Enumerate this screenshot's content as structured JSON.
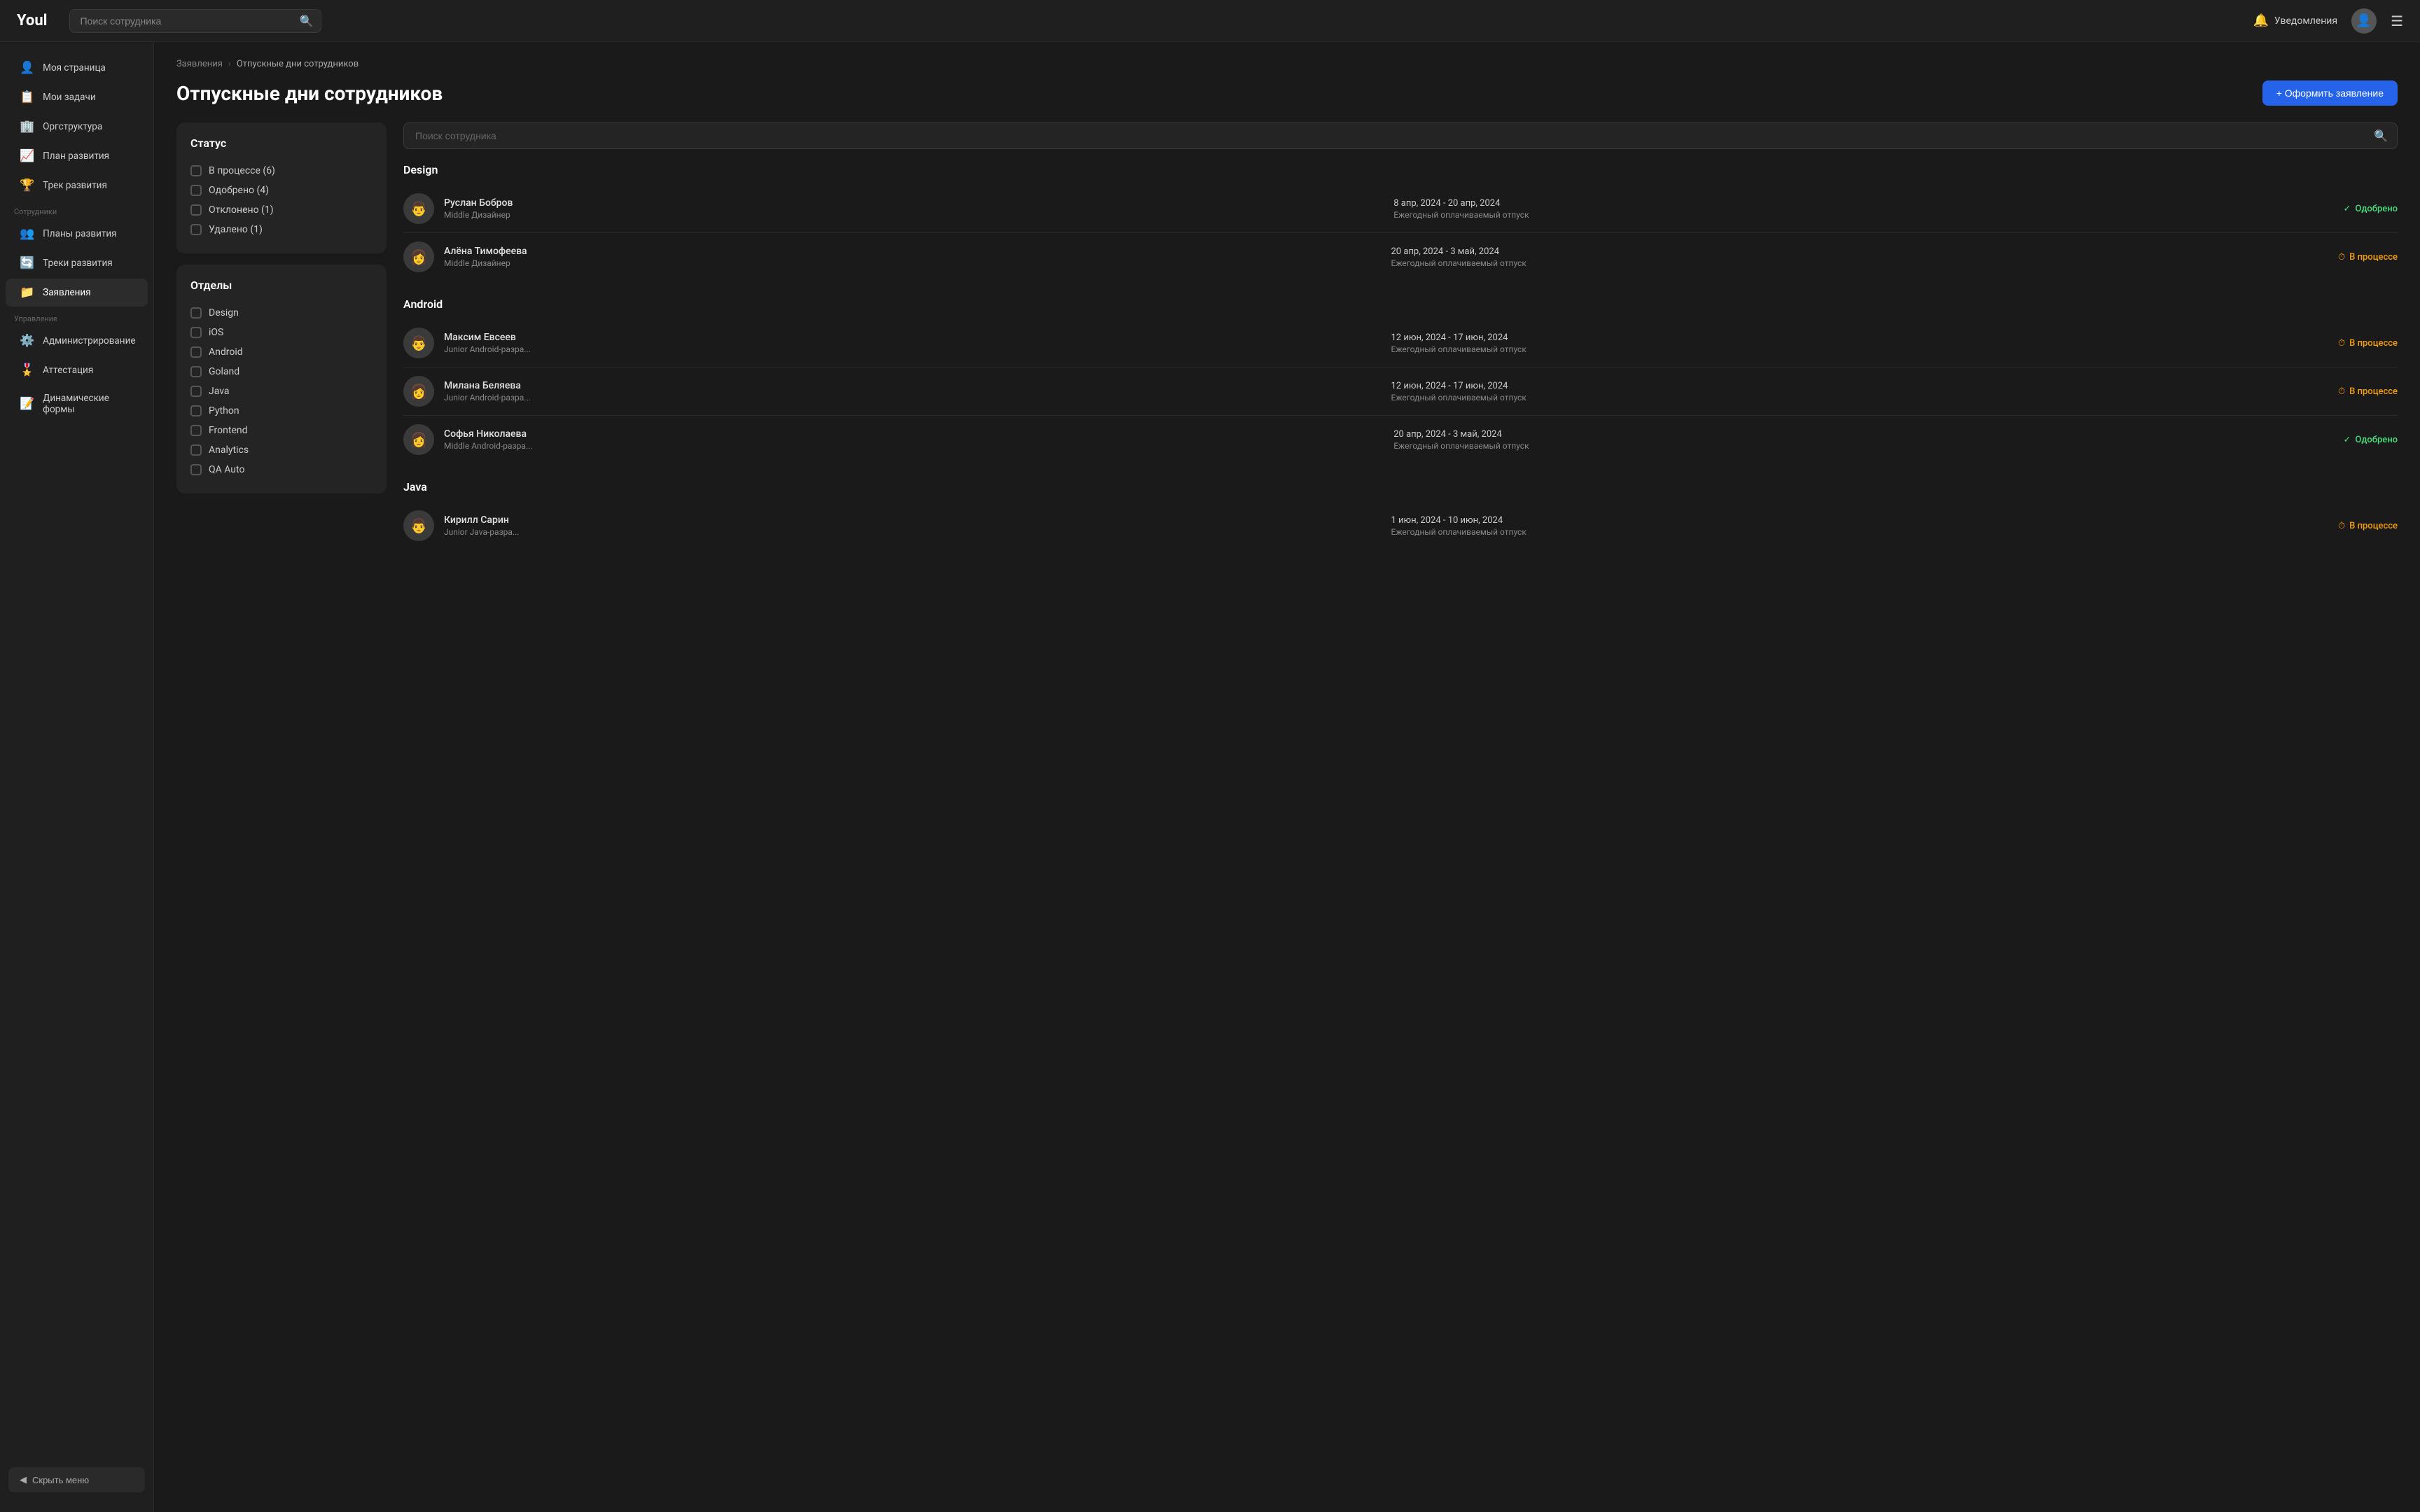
{
  "app": {
    "logo": "Youl"
  },
  "header": {
    "search_placeholder": "Поиск сотрудника",
    "notifications_label": "Уведомления",
    "hamburger_label": "Меню"
  },
  "sidebar": {
    "items": [
      {
        "id": "my-page",
        "label": "Моя страница",
        "icon": "👤"
      },
      {
        "id": "my-tasks",
        "label": "Мои задачи",
        "icon": "📋"
      },
      {
        "id": "org-structure",
        "label": "Оргструктура",
        "icon": "🏢"
      },
      {
        "id": "dev-plan",
        "label": "План развития",
        "icon": "📈"
      },
      {
        "id": "dev-track",
        "label": "Трек развития",
        "icon": "🏆"
      }
    ],
    "section_employees": "Сотрудники",
    "employee_items": [
      {
        "id": "dev-plans",
        "label": "Планы развития",
        "icon": "👥"
      },
      {
        "id": "dev-tracks",
        "label": "Треки развития",
        "icon": "🔄"
      },
      {
        "id": "applications",
        "label": "Заявления",
        "icon": "📁",
        "active": true
      }
    ],
    "section_management": "Управление",
    "management_items": [
      {
        "id": "admin",
        "label": "Администрирование",
        "icon": "⚙️"
      },
      {
        "id": "attestation",
        "label": "Аттестация",
        "icon": "🎖️"
      },
      {
        "id": "dynamic-forms",
        "label": "Динамические формы",
        "icon": "📝"
      }
    ],
    "hide_menu_label": "Скрыть меню"
  },
  "breadcrumb": {
    "parent": "Заявления",
    "current": "Отпускные дни сотрудников"
  },
  "page": {
    "title": "Отпускные дни сотрудников",
    "create_button": "+ Оформить заявление"
  },
  "filters": {
    "status_title": "Статус",
    "statuses": [
      {
        "label": "В процессе (6)",
        "checked": false
      },
      {
        "label": "Одобрено (4)",
        "checked": false
      },
      {
        "label": "Отклонено (1)",
        "checked": false
      },
      {
        "label": "Удалено (1)",
        "checked": false
      }
    ],
    "departments_title": "Отделы",
    "departments": [
      {
        "label": "Design",
        "checked": false
      },
      {
        "label": "iOS",
        "checked": false
      },
      {
        "label": "Android",
        "checked": false
      },
      {
        "label": "Goland",
        "checked": false
      },
      {
        "label": "Java",
        "checked": false
      },
      {
        "label": "Python",
        "checked": false
      },
      {
        "label": "Frontend",
        "checked": false
      },
      {
        "label": "Analytics",
        "checked": false
      },
      {
        "label": "QA Auto",
        "checked": false
      }
    ]
  },
  "employee_search_placeholder": "Поиск сотрудника",
  "groups": [
    {
      "dept": "Design",
      "employees": [
        {
          "name": "Руслан Бобров",
          "role": "Middle Дизайнер",
          "date_range": "8 апр, 2024 - 20 апр, 2024",
          "leave_type": "Ежегодный оплачиваемый отпуск",
          "status": "Одобрено",
          "status_type": "approved",
          "avatar_emoji": "👨"
        },
        {
          "name": "Алёна Тимофеева",
          "role": "Middle Дизайнер",
          "date_range": "20 апр, 2024 - 3 май, 2024",
          "leave_type": "Ежегодный оплачиваемый отпуск",
          "status": "В процессе",
          "status_type": "pending",
          "avatar_emoji": "👩"
        }
      ]
    },
    {
      "dept": "Android",
      "employees": [
        {
          "name": "Максим Евсеев",
          "role": "Junior Android-разра...",
          "date_range": "12 июн, 2024 - 17 июн, 2024",
          "leave_type": "Ежегодный оплачиваемый отпуск",
          "status": "В процессе",
          "status_type": "pending",
          "avatar_emoji": "👨"
        },
        {
          "name": "Милана Беляева",
          "role": "Junior Android-разра...",
          "date_range": "12 июн, 2024 - 17 июн, 2024",
          "leave_type": "Ежегодный оплачиваемый отпуск",
          "status": "В процессе",
          "status_type": "pending",
          "avatar_emoji": "👩"
        },
        {
          "name": "Софья Николаева",
          "role": "Middle Android-разра...",
          "date_range": "20 апр, 2024 - 3 май, 2024",
          "leave_type": "Ежегодный оплачиваемый отпуск",
          "status": "Одобрено",
          "status_type": "approved",
          "avatar_emoji": "👩"
        }
      ]
    },
    {
      "dept": "Java",
      "employees": [
        {
          "name": "Кирилл Сарин",
          "role": "Junior Java-разра...",
          "date_range": "1 июн, 2024 - 10 июн, 2024",
          "leave_type": "Ежегодный оплачиваемый отпуск",
          "status": "В процессе",
          "status_type": "pending",
          "avatar_emoji": "👨"
        }
      ]
    }
  ]
}
